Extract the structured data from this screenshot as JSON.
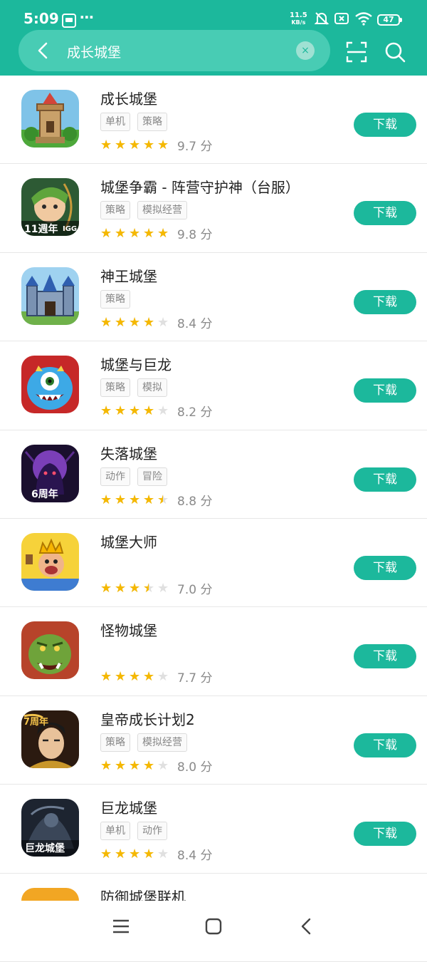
{
  "status_bar": {
    "time": "5:09",
    "more": "⋯",
    "speed_top": "11.5",
    "speed_bottom": "KB/s",
    "battery": "47"
  },
  "search": {
    "query": "成长城堡",
    "clear": "×"
  },
  "apps": [
    {
      "name": "成长城堡",
      "tags": [
        "单机",
        "策略"
      ],
      "stars": 5,
      "score": "9.7 分",
      "download": "下载",
      "icon": "castle-tower"
    },
    {
      "name": "城堡争霸 - 阵营守护神（台服）",
      "tags": [
        "策略",
        "模拟经营"
      ],
      "stars": 5,
      "score": "9.8 分",
      "download": "下载",
      "icon": "archer-girl",
      "icon_text": "11週年",
      "icon_badge": "IGG"
    },
    {
      "name": "神王城堡",
      "tags": [
        "策略"
      ],
      "stars": 4,
      "score": "8.4 分",
      "download": "下载",
      "icon": "blue-castle"
    },
    {
      "name": "城堡与巨龙",
      "tags": [
        "策略",
        "模拟"
      ],
      "stars": 4,
      "score": "8.2 分",
      "download": "下载",
      "icon": "blue-monster"
    },
    {
      "name": "失落城堡",
      "tags": [
        "动作",
        "冒险"
      ],
      "stars": 4.5,
      "score": "8.8 分",
      "download": "下载",
      "icon": "dark-purple",
      "icon_text": "6周年"
    },
    {
      "name": "城堡大师",
      "tags": [],
      "stars": 3.5,
      "score": "7.0 分",
      "download": "下载",
      "icon": "king-cartoon"
    },
    {
      "name": "怪物城堡",
      "tags": [],
      "stars": 4,
      "score": "7.7 分",
      "download": "下载",
      "icon": "green-orc"
    },
    {
      "name": "皇帝成长计划2",
      "tags": [
        "策略",
        "模拟经营"
      ],
      "stars": 4,
      "score": "8.0 分",
      "download": "下载",
      "icon": "emperor",
      "icon_text": "7周年"
    },
    {
      "name": "巨龙城堡",
      "tags": [
        "单机",
        "动作"
      ],
      "stars": 4,
      "score": "8.4 分",
      "download": "下载",
      "icon": "dark-knight",
      "icon_text": "巨龙城堡"
    },
    {
      "name": "防御城堡联机",
      "tags": [],
      "stars": 0,
      "score": "",
      "download": "",
      "icon": "defense-castle"
    }
  ],
  "colors": {
    "accent": "#1cb89c",
    "star": "#f5b800"
  }
}
